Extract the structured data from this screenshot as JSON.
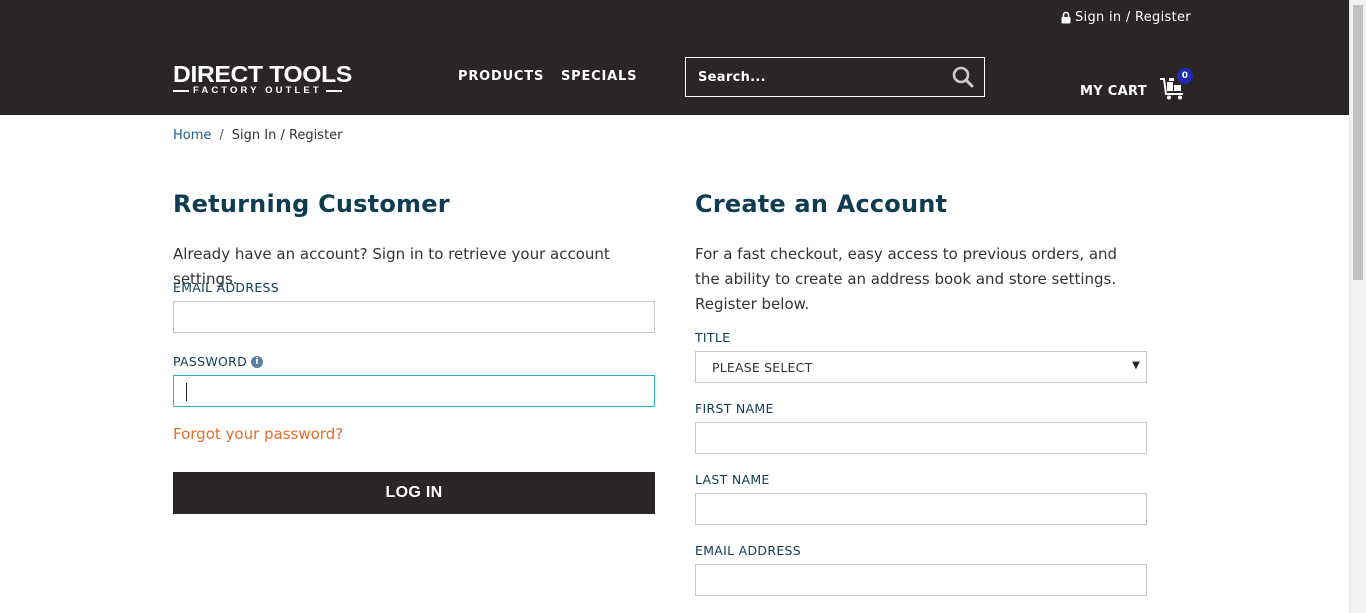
{
  "header": {
    "signin_label": "Sign in / Register",
    "logo_top": "DIRECT TOOLS",
    "logo_sub": "FACTORY OUTLET",
    "nav": [
      {
        "label": "PRODUCTS"
      },
      {
        "label": "SPECIALS"
      }
    ],
    "search_placeholder": "Search...",
    "cart_label": "MY CART",
    "cart_count": "0",
    "colors": {
      "background": "#2a2626",
      "badge": "#1f2bb5"
    }
  },
  "breadcrumb": {
    "home": "Home",
    "separator": "/",
    "current": "Sign In / Register"
  },
  "returning": {
    "heading": "Returning Customer",
    "description": "Already have an account? Sign in to retrieve your account settings.",
    "email_label": "EMAIL ADDRESS",
    "email_value": "",
    "password_label": "PASSWORD",
    "password_info_icon": "i",
    "password_value": "",
    "forgot_label": "Forgot your password?",
    "login_label": "LOG IN"
  },
  "create": {
    "heading": "Create an Account",
    "description": "For a fast checkout, easy access to previous orders, and the ability to create an address book and store settings. Register below.",
    "title_label": "TITLE",
    "title_selected": "PLEASE SELECT",
    "first_name_label": "FIRST NAME",
    "last_name_label": "LAST NAME",
    "email_label": "EMAIL ADDRESS"
  },
  "colors": {
    "heading": "#0e3d52",
    "link": "#1f5f8b",
    "forgot": "#e86c2a",
    "focus_border": "#33b0c8"
  }
}
